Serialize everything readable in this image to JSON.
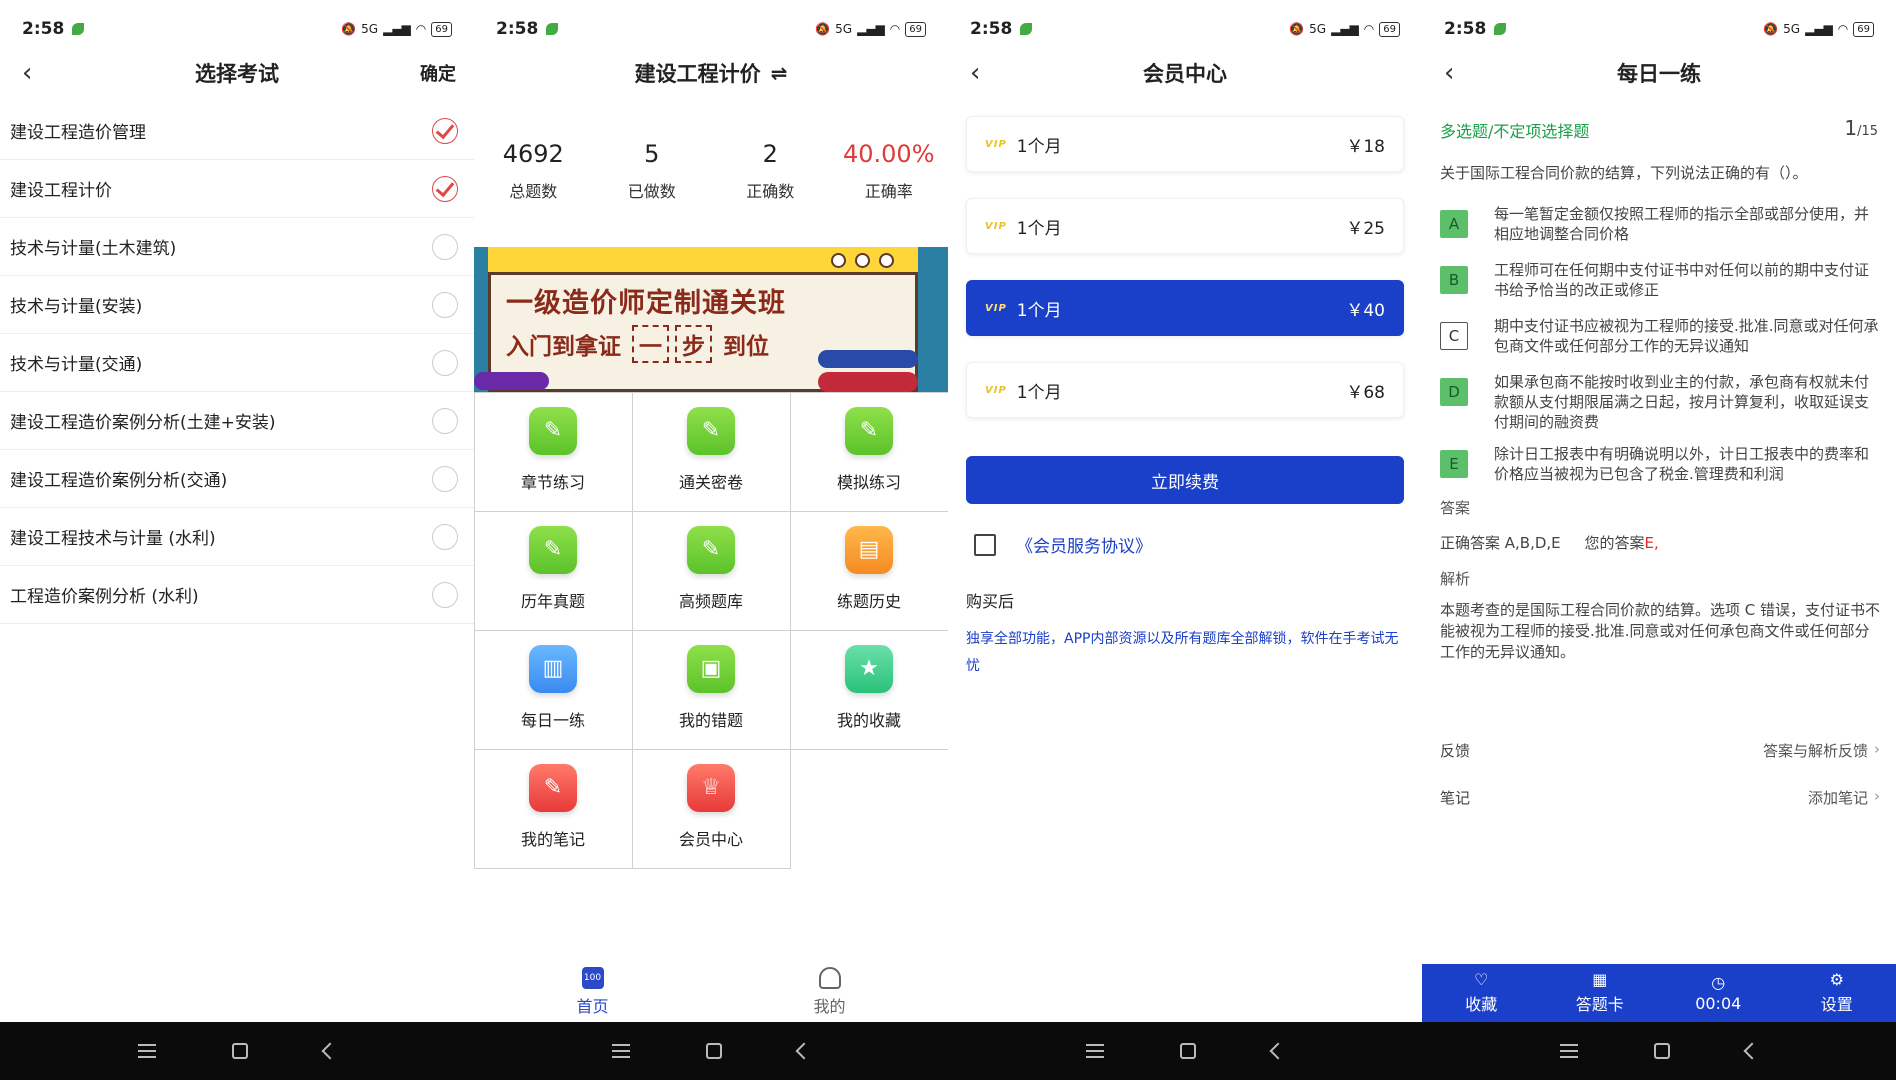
{
  "status": {
    "time": "2:58",
    "network": "5G",
    "battery": "69"
  },
  "screen1": {
    "title": "选择考试",
    "confirm": "确定",
    "exams": [
      {
        "label": "建设工程造价管理",
        "checked": true
      },
      {
        "label": "建设工程计价",
        "checked": true
      },
      {
        "label": "技术与计量(土木建筑)",
        "checked": false
      },
      {
        "label": "技术与计量(安装)",
        "checked": false
      },
      {
        "label": "技术与计量(交通)",
        "checked": false
      },
      {
        "label": "建设工程造价案例分析(土建+安装)",
        "checked": false
      },
      {
        "label": "建设工程造价案例分析(交通)",
        "checked": false
      },
      {
        "label": "建设工程技术与计量 (水利)",
        "checked": false
      },
      {
        "label": "工程造价案例分析 (水利)",
        "checked": false
      }
    ]
  },
  "screen2": {
    "title": "建设工程计价",
    "switch_icon": "⇌",
    "stats": [
      {
        "value": "4692",
        "label": "总题数"
      },
      {
        "value": "5",
        "label": "已做数"
      },
      {
        "value": "2",
        "label": "正确数"
      },
      {
        "value": "40.00%",
        "label": "正确率"
      }
    ],
    "banner": {
      "line1": "一级造价师定制通关班",
      "line2a": "入门到拿证",
      "box1": "一",
      "box2": "步",
      "line2b": "到位"
    },
    "menu": [
      {
        "label": "章节练习",
        "icon": "pencil-icon",
        "color": "g"
      },
      {
        "label": "通关密卷",
        "icon": "pencil-icon",
        "color": "g"
      },
      {
        "label": "模拟练习",
        "icon": "pencil-icon",
        "color": "g"
      },
      {
        "label": "历年真题",
        "icon": "pencil-icon",
        "color": "g"
      },
      {
        "label": "高频题库",
        "icon": "pencil-icon",
        "color": "g"
      },
      {
        "label": "练题历史",
        "icon": "document-icon",
        "color": "o"
      },
      {
        "label": "每日一练",
        "icon": "file-icon",
        "color": "b"
      },
      {
        "label": "我的错题",
        "icon": "book-icon",
        "color": "g"
      },
      {
        "label": "我的收藏",
        "icon": "star-folder-icon",
        "color": "t"
      },
      {
        "label": "我的笔记",
        "icon": "pencil-icon",
        "color": "r"
      },
      {
        "label": "会员中心",
        "icon": "trophy-icon",
        "color": "r"
      }
    ],
    "tabs": [
      {
        "label": "首页",
        "icon_text": "100"
      },
      {
        "label": "我的"
      }
    ]
  },
  "screen3": {
    "title": "会员中心",
    "vip_badge": "VIP",
    "plans": [
      {
        "label": "1个月",
        "price": "￥18"
      },
      {
        "label": "1个月",
        "price": "￥25"
      },
      {
        "label": "1个月",
        "price": "￥40"
      },
      {
        "label": "1个月",
        "price": "￥68"
      }
    ],
    "renew": "立即续费",
    "agreement": "《会员服务协议》",
    "after_buy": "购买后",
    "benefit": "独享全部功能，APP内部资源以及所有题库全部解锁，软件在手考试无忧"
  },
  "screen4": {
    "title": "每日一练",
    "qtype": "多选题/不定项选择题",
    "qnum": "1",
    "qtotal": "/15",
    "question": "关于国际工程合同价款的结算，下列说法正确的有（）。",
    "options": [
      {
        "key": "A",
        "text": "每一笔暂定金额仅按照工程师的指示全部或部分使用，并相应地调整合同价格",
        "on": true
      },
      {
        "key": "B",
        "text": "工程师可在任何期中支付证书中对任何以前的期中支付证书给予恰当的改正或修正",
        "on": true
      },
      {
        "key": "C",
        "text": "期中支付证书应被视为工程师的接受.批准.同意或对任何承包商文件或任何部分工作的无异议通知",
        "on": false
      },
      {
        "key": "D",
        "text": "如果承包商不能按时收到业主的付款，承包商有权就未付款额从支付期限届满之日起，按月计算复利，收取延误支付期间的融资费",
        "on": true
      },
      {
        "key": "E",
        "text": "除计日工报表中有明确说明以外，计日工报表中的费率和价格应当被视为已包含了税金.管理费和利润",
        "on": true
      }
    ],
    "answer_label": "答案",
    "correct": "正确答案 A,B,D,E",
    "yours_label": "您的答案",
    "yours": "E,",
    "explain_label": "解析",
    "explain": "本题考查的是国际工程合同价款的结算。选项 C 错误，支付证书不能被视为工程师的接受.批准.同意或对任何承包商文件或任何部分工作的无异议通知。",
    "feedback_label": "反馈",
    "feedback_value": "答案与解析反馈",
    "note_label": "笔记",
    "note_value": "添加笔记",
    "bottom": [
      {
        "label": "收藏",
        "icon": "♡"
      },
      {
        "label": "答题卡",
        "icon": "▦"
      },
      {
        "label": "00:04",
        "icon": "◷"
      },
      {
        "label": "设置",
        "icon": "⚙"
      }
    ]
  }
}
